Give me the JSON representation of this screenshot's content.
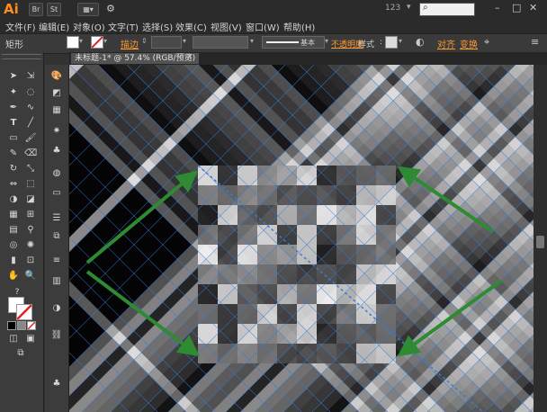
{
  "app": {
    "logo": "Ai"
  },
  "titlebar": {
    "workspace_number": "123",
    "search_placeholder": ""
  },
  "menu": [
    {
      "label": "文件(F)"
    },
    {
      "label": "编辑(E)"
    },
    {
      "label": "对象(O)"
    },
    {
      "label": "文字(T)"
    },
    {
      "label": "选择(S)"
    },
    {
      "label": "效果(C)"
    },
    {
      "label": "视图(V)"
    },
    {
      "label": "窗口(W)"
    },
    {
      "label": "帮助(H)"
    }
  ],
  "control": {
    "object_type": "矩形",
    "stroke_label": "描边",
    "stroke_style_label": "基本",
    "opacity_label": "不透明度",
    "style_label": "样式",
    "align_label": "对齐",
    "transform_label": "变换"
  },
  "document": {
    "tab_title": "未标题-1* @ 57.4% (RGB/预览)"
  },
  "colors": {
    "accent": "#ff9a2e",
    "logo": "#ff8a1e",
    "arrow": "#2f8a34",
    "guide": "#3a7bd5"
  }
}
